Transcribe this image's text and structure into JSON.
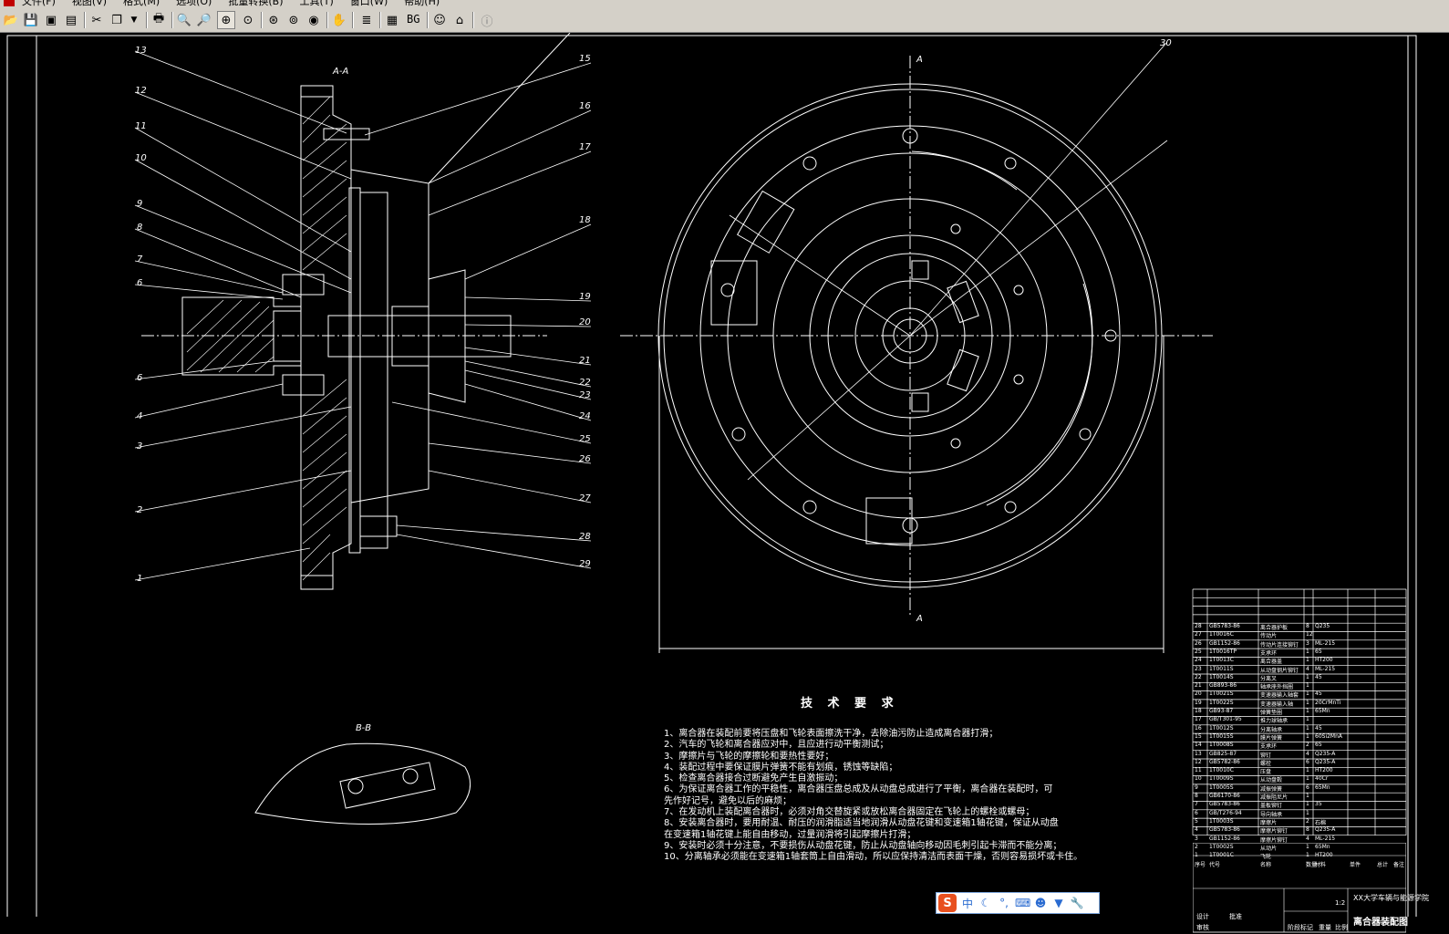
{
  "menu": {
    "items": [
      "文件(F)",
      "视图(V)",
      "格式(M)",
      "选项(O)",
      "批量转换(B)",
      "工具(T)",
      "窗口(W)",
      "帮助(H)"
    ]
  },
  "toolbar": {
    "bg_label": "BG",
    "buttons": [
      "open-icon",
      "save-icon",
      "save-as-icon",
      "export-icon",
      "cut-icon",
      "copy-icon",
      "print-icon",
      "zoom-out-icon",
      "zoom-in-icon",
      "zoom-window-icon",
      "zoom-realtime-icon",
      "zoom-extents-icon",
      "zoom-previous-icon",
      "view-icon",
      "pan-icon",
      "layers-icon",
      "display-icon",
      "person-icon",
      "home-icon",
      "info-icon"
    ]
  },
  "drawing": {
    "section_aa": "A-A",
    "section_bb": "B-B",
    "section_marker": "A",
    "left_labels": [
      "13",
      "12",
      "11",
      "10",
      "9",
      "8",
      "7",
      "6",
      "5",
      "4",
      "3",
      "2",
      "1"
    ],
    "right_labels": [
      "15",
      "16",
      "17",
      "18",
      "19",
      "20",
      "21",
      "22",
      "23",
      "24",
      "25",
      "26",
      "27",
      "28",
      "29"
    ],
    "view_label": "30"
  },
  "technical_requirements": {
    "title": "技 术 要 求",
    "lines": [
      "1、离合器在装配前要将压盘和飞轮表面擦洗干净，去除油污防止造成离合器打滑；",
      "2、汽车的飞轮和离合器应对中，且应进行动平衡测试；",
      "3、摩擦片与飞轮的摩擦轮和要热性要好；",
      "4、装配过程中要保证膜片弹簧不能有划痕，锈蚀等缺陷；",
      "5、检查离合器接合过断避免产生自激振动；",
      "6、为保证离合器工作的平稳性，离合器压盘总成及从动盘总成进行了平衡，离合器在装配时，可",
      "   先作好记号，避免以后的麻烦；",
      "7、在发动机上装配离合器时，必须对角交替旋紧或放松离合器固定在飞轮上的螺栓或螺母；",
      "8、安装离合器时，要用耐温、耐压的润滑脂适当地润滑从动盘花键和变速箱1轴花键，保证从动盘",
      "   在变速箱1轴花键上能自由移动，过量润滑将引起摩擦片打滑；",
      "9、安装时必须十分注意，不要损伤从动盘花键，防止从动盘轴向移动因毛刺引起卡滞而不能分离；",
      "10、分离轴承必须能在变速箱1轴套筒上自由滑动，所以应保持清洁而表面干燥，否则容易损坏或卡住。"
    ]
  },
  "ime_toolbar": {
    "logo": "S",
    "mode": "中",
    "icons": [
      "moon-icon",
      "punctuation-icon",
      "keyboard-icon",
      "person-icon",
      "shirt-icon",
      "wrench-icon"
    ]
  },
  "title_block": {
    "drawing_name": "离合器装配图",
    "school": "XX大学车辆与能源学院",
    "stage_label": "阶段标记",
    "weight_label": "重量",
    "scale_label": "比例",
    "scale_value": "1:2",
    "designer_label": "设计",
    "checker_label": "审核",
    "approver_label": "批准",
    "header_cols": [
      "序号",
      "代号",
      "名称",
      "数量",
      "材料",
      "单件",
      "总计",
      "备注"
    ]
  },
  "parts_list": [
    {
      "code": "GB5783-86",
      "name": "离合器护板",
      "qty": "8",
      "mat": "Q235"
    },
    {
      "code": "1T0016C",
      "name": "传动片",
      "qty": "12",
      "mat": ""
    },
    {
      "code": "GB1152-86",
      "name": "传动片连接铆钉",
      "qty": "3",
      "mat": "ML-215"
    },
    {
      "code": "1T0016TP",
      "name": "支承环",
      "qty": "1",
      "mat": "65"
    },
    {
      "code": "1T0013C",
      "name": "离合器盖",
      "qty": "1",
      "mat": "HT200"
    },
    {
      "code": "1T0011S",
      "name": "从动盘钢片铆钉",
      "qty": "4",
      "mat": "ML-215"
    },
    {
      "code": "1T0014S",
      "name": "分离叉",
      "qty": "1",
      "mat": "45"
    },
    {
      "code": "GB893-86",
      "name": "轴承座外挡圈",
      "qty": "1",
      "mat": ""
    },
    {
      "code": "1T0021S",
      "name": "变速器输入轴套",
      "qty": "1",
      "mat": "45"
    },
    {
      "code": "1T0022S",
      "name": "变速器输入轴",
      "qty": "1",
      "mat": "20CrMnTi"
    },
    {
      "code": "GB93-87",
      "name": "弹簧垫圈",
      "qty": "1",
      "mat": "65Mn"
    },
    {
      "code": "GB/T301-95",
      "name": "推力球轴承",
      "qty": "1",
      "mat": ""
    },
    {
      "code": "1T0012S",
      "name": "分离轴承",
      "qty": "1",
      "mat": "45"
    },
    {
      "code": "1T0015S",
      "name": "膜片弹簧",
      "qty": "1",
      "mat": "60Si2MnA"
    },
    {
      "code": "1T0008S",
      "name": "支承环",
      "qty": "2",
      "mat": "65"
    },
    {
      "code": "GB825-87",
      "name": "铆钉",
      "qty": "4",
      "mat": "Q235-A"
    },
    {
      "code": "GB5782-86",
      "name": "螺栓",
      "qty": "6",
      "mat": "Q235-A"
    },
    {
      "code": "1T0010C",
      "name": "压盘",
      "qty": "1",
      "mat": "HT200"
    },
    {
      "code": "1T0009S",
      "name": "从动盘毂",
      "qty": "1",
      "mat": "40Cr"
    },
    {
      "code": "1T0005S",
      "name": "减振弹簧",
      "qty": "6",
      "mat": "65Mn"
    },
    {
      "code": "GB6170-86",
      "name": "减振阻尼片",
      "qty": "1",
      "mat": ""
    },
    {
      "code": "GB5783-86",
      "name": "盖板铆钉",
      "qty": "1",
      "mat": "35"
    },
    {
      "code": "GB/T276-94",
      "name": "导向轴承",
      "qty": "1",
      "mat": ""
    },
    {
      "code": "1T0003S",
      "name": "摩擦片",
      "qty": "2",
      "mat": "石棉"
    },
    {
      "code": "GB5783-86",
      "name": "摩擦片铆钉",
      "qty": "8",
      "mat": "Q235-A"
    },
    {
      "code": "GB1152-86",
      "name": "摩擦片铆钉",
      "qty": "4",
      "mat": "ML-215"
    },
    {
      "code": "1T0002S",
      "name": "从动片",
      "qty": "1",
      "mat": "65Mn"
    },
    {
      "code": "1T0001C",
      "name": "飞轮",
      "qty": "1",
      "mat": "HT200"
    }
  ]
}
